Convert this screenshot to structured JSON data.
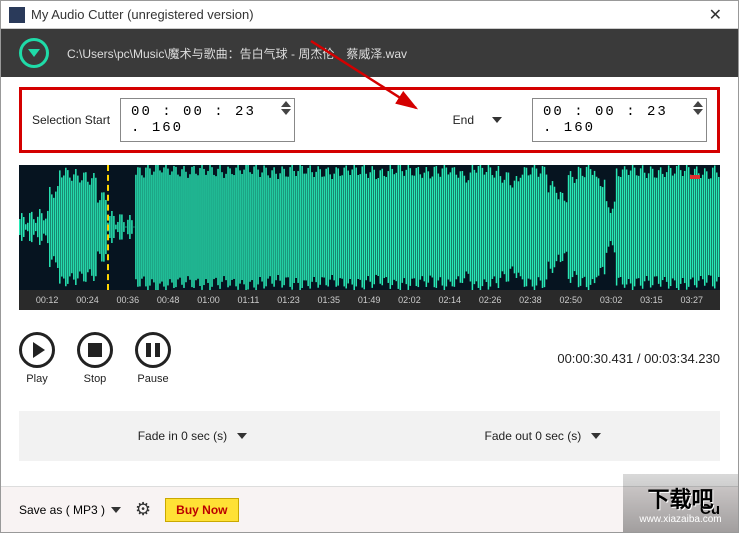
{
  "window": {
    "title": "My Audio Cutter (unregistered version)"
  },
  "header": {
    "path": "C:\\Users\\pc\\Music\\魔术与歌曲：告白气球 - 周杰伦、蔡威泽.wav"
  },
  "selection": {
    "start_label": "Selection Start",
    "start_value": "00 : 00 : 23 . 160",
    "end_label": "End",
    "end_value": "00 : 00 : 23 . 160"
  },
  "ruler": {
    "ticks": [
      "00:12",
      "00:24",
      "00:36",
      "00:48",
      "01:00",
      "01:11",
      "01:23",
      "01:35",
      "01:49",
      "02:02",
      "02:14",
      "02:26",
      "02:38",
      "02:50",
      "03:02",
      "03:15",
      "03:27"
    ]
  },
  "controls": {
    "play": "Play",
    "stop": "Stop",
    "pause": "Pause"
  },
  "time": {
    "display": "00:00:30.431 / 00:03:34.230"
  },
  "fade": {
    "in_label": "Fade in 0 sec (s)",
    "out_label": "Fade out 0 sec (s)"
  },
  "bottom": {
    "saveas": "Save as ( MP3 )",
    "buynow": "Buy Now",
    "cut_hint": "Cu"
  },
  "watermark": {
    "text": "下载吧",
    "url": "www.xiazaiba.com"
  }
}
